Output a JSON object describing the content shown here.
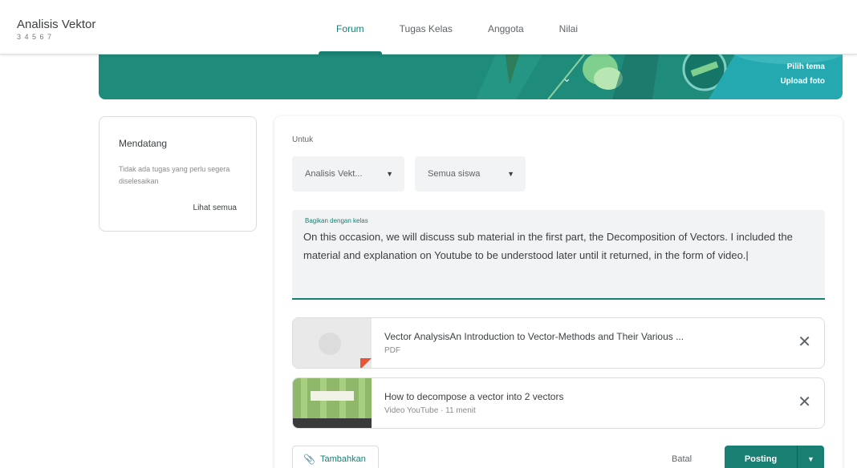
{
  "header": {
    "class_title": "Analisis Vektor",
    "class_section": "3 4 5 6 7",
    "tabs": [
      {
        "label": "Forum",
        "active": true
      },
      {
        "label": "Tugas Kelas",
        "active": false
      },
      {
        "label": "Anggota",
        "active": false
      },
      {
        "label": "Nilai",
        "active": false
      }
    ]
  },
  "banner": {
    "select_theme": "Pilih tema",
    "upload_photo": "Upload foto",
    "color": "#1f8c7b"
  },
  "upcoming": {
    "title": "Mendatang",
    "empty_text": "Tidak ada tugas yang perlu segera diselesaikan",
    "view_all": "Lihat semua"
  },
  "composer": {
    "for_label": "Untuk",
    "class_select": "Analisis Vekt...",
    "audience_select": "Semua siswa",
    "textarea_label": "Bagikan dengan kelas",
    "textarea_value": "On this occasion, we will discuss sub material in the first part, the Decomposition of Vectors. I included the material and explanation on Youtube to be understood later until it returned, in the form of video.|",
    "attachments": [
      {
        "title": "Vector AnalysisAn Introduction to Vector-Methods and Their Various ...",
        "subtitle": "PDF",
        "icon": "pdf-icon"
      },
      {
        "title": "How to decompose a vector into 2 vectors",
        "subtitle": "Video YouTube · 11 menit",
        "icon": "youtube-thumbnail"
      }
    ],
    "add_button": "Tambahkan",
    "cancel_button": "Batal",
    "post_button": "Posting",
    "accent_color": "#1a7f73"
  }
}
